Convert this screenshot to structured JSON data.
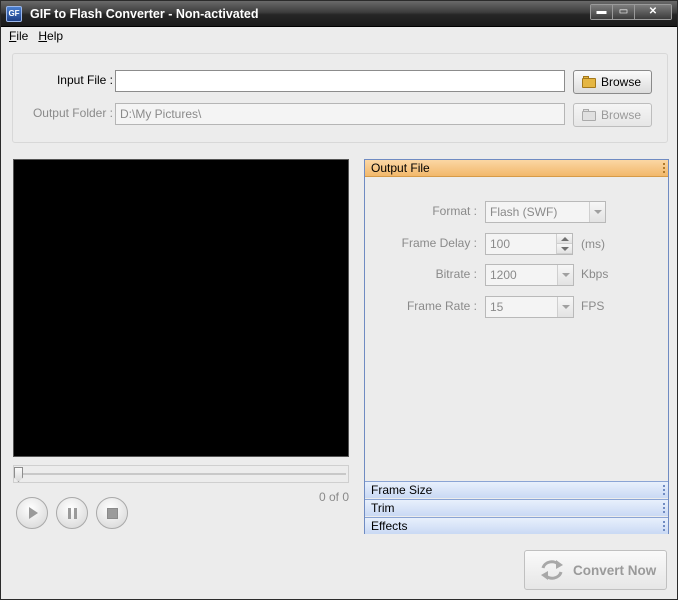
{
  "window": {
    "title": "GIF to Flash Converter - Non-activated",
    "icon": "app-icon",
    "controls": {
      "minimize": "▬",
      "maximize": "▭",
      "close": "✕"
    }
  },
  "menu": {
    "items": [
      {
        "first": "F",
        "rest": "ile"
      },
      {
        "first": "H",
        "rest": "elp"
      }
    ]
  },
  "files": {
    "input_label": "Input File :",
    "input_value": "",
    "output_label": "Output Folder :",
    "output_value": "D:\\My Pictures\\",
    "browse_label": "Browse",
    "browse_disabled_label": "Browse"
  },
  "player": {
    "counter": "0 of 0",
    "progress": 0
  },
  "settings": {
    "active_section": "Output File",
    "format_label": "Format :",
    "format_value": "Flash (SWF)",
    "frame_delay_label": "Frame Delay :",
    "frame_delay_value": "100",
    "frame_delay_unit": "(ms)",
    "bitrate_label": "Bitrate :",
    "bitrate_value": "1200",
    "bitrate_unit": "Kbps",
    "frame_rate_label": "Frame Rate :",
    "frame_rate_value": "15",
    "frame_rate_unit": "FPS",
    "sections": [
      "Frame Size",
      "Trim",
      "Effects"
    ]
  },
  "actions": {
    "convert_label": "Convert Now"
  },
  "colors": {
    "active_header": "#f2b86b",
    "collapsed_header": "#c9d9f4",
    "panel_border": "#6f8bc2"
  }
}
